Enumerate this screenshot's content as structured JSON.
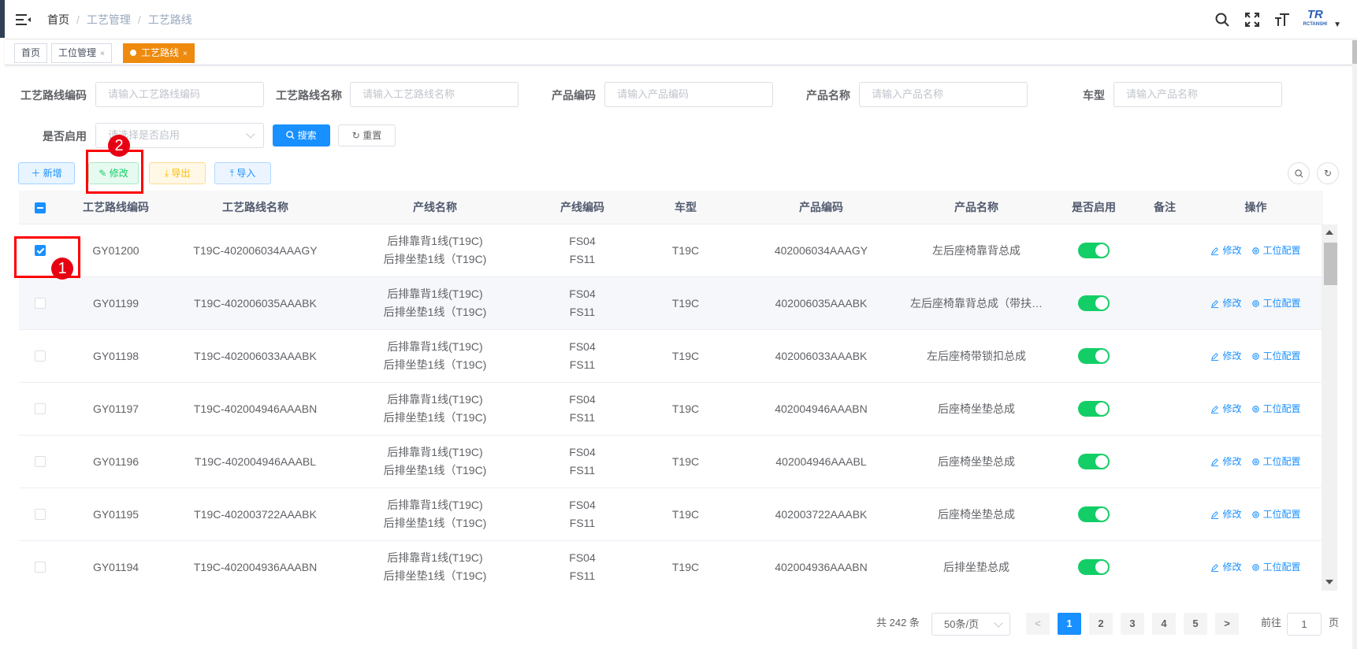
{
  "breadcrumb": {
    "home": "首页",
    "level2": "工艺管理",
    "level3": "工艺路线"
  },
  "top_icons": [
    "search-icon",
    "fullscreen-icon",
    "font-size-icon"
  ],
  "logo": {
    "text": "TR",
    "sub": "RCTANSHI"
  },
  "tags": [
    {
      "label": "首页",
      "closable": false,
      "active": false
    },
    {
      "label": "工位管理",
      "closable": true,
      "active": false
    },
    {
      "label": "工艺路线",
      "closable": true,
      "active": true
    }
  ],
  "tag_close": "×",
  "filters": {
    "route_code": {
      "label": "工艺路线编码",
      "placeholder": "请输入工艺路线编码"
    },
    "route_name": {
      "label": "工艺路线名称",
      "placeholder": "请输入工艺路线名称"
    },
    "product_code": {
      "label": "产品编码",
      "placeholder": "请输入产品编码"
    },
    "product_name": {
      "label": "产品名称",
      "placeholder": "请输入产品名称"
    },
    "car_model": {
      "label": "车型",
      "placeholder": "请输入产品名称"
    },
    "enabled": {
      "label": "是否启用",
      "placeholder": "请选择是否启用"
    }
  },
  "buttons": {
    "search": "搜索",
    "reset": "重置",
    "add": "新增",
    "edit": "修改",
    "export": "导出",
    "import": "导入"
  },
  "columns": [
    "工艺路线编码",
    "工艺路线名称",
    "产线名称",
    "产线编码",
    "车型",
    "产品编码",
    "产品名称",
    "是否启用",
    "备注",
    "操作"
  ],
  "rows": [
    {
      "code": "GY01200",
      "name": "T19C-402006034AAAGY",
      "line1": "后排靠背1线(T19C)",
      "line2": "后排坐垫1线（T19C)",
      "lc1": "FS04",
      "lc2": "FS11",
      "model": "T19C",
      "pcode": "402006034AAAGY",
      "pname": "左后座椅靠背总成",
      "enabled": true,
      "remark": "",
      "checked": true
    },
    {
      "code": "GY01199",
      "name": "T19C-402006035AAABK",
      "line1": "后排靠背1线(T19C)",
      "line2": "后排坐垫1线（T19C)",
      "lc1": "FS04",
      "lc2": "FS11",
      "model": "T19C",
      "pcode": "402006035AAABK",
      "pname": "左后座椅靠背总成（带扶…",
      "enabled": true,
      "remark": "",
      "checked": false
    },
    {
      "code": "GY01198",
      "name": "T19C-402006033AAABK",
      "line1": "后排靠背1线(T19C)",
      "line2": "后排坐垫1线（T19C)",
      "lc1": "FS04",
      "lc2": "FS11",
      "model": "T19C",
      "pcode": "402006033AAABK",
      "pname": "左后座椅带锁扣总成",
      "enabled": true,
      "remark": "",
      "checked": false
    },
    {
      "code": "GY01197",
      "name": "T19C-402004946AAABN",
      "line1": "后排靠背1线(T19C)",
      "line2": "后排坐垫1线（T19C)",
      "lc1": "FS04",
      "lc2": "FS11",
      "model": "T19C",
      "pcode": "402004946AAABN",
      "pname": "后座椅坐垫总成",
      "enabled": true,
      "remark": "",
      "checked": false
    },
    {
      "code": "GY01196",
      "name": "T19C-402004946AAABL",
      "line1": "后排靠背1线(T19C)",
      "line2": "后排坐垫1线（T19C)",
      "lc1": "FS04",
      "lc2": "FS11",
      "model": "T19C",
      "pcode": "402004946AAABL",
      "pname": "后座椅坐垫总成",
      "enabled": true,
      "remark": "",
      "checked": false
    },
    {
      "code": "GY01195",
      "name": "T19C-402003722AAABK",
      "line1": "后排靠背1线(T19C)",
      "line2": "后排坐垫1线（T19C)",
      "lc1": "FS04",
      "lc2": "FS11",
      "model": "T19C",
      "pcode": "402003722AAABK",
      "pname": "后座椅坐垫总成",
      "enabled": true,
      "remark": "",
      "checked": false
    },
    {
      "code": "GY01194",
      "name": "T19C-402004936AAABN",
      "line1": "后排靠背1线(T19C)",
      "line2": "后排坐垫1线（T19C)",
      "lc1": "FS04",
      "lc2": "FS11",
      "model": "T19C",
      "pcode": "402004936AAABN",
      "pname": "后排坐垫总成",
      "enabled": true,
      "remark": "",
      "checked": false
    }
  ],
  "row_actions": {
    "edit": "修改",
    "config": "工位配置"
  },
  "pagination": {
    "total_text": "共 242 条",
    "page_size": "50条/页",
    "pages": [
      "1",
      "2",
      "3",
      "4",
      "5"
    ],
    "current": "1",
    "goto_label": "前往",
    "goto_value": "1",
    "page_suffix": "页",
    "prev": "<",
    "next": ">"
  },
  "annotations": {
    "badge1": "1",
    "badge2": "2"
  },
  "colors": {
    "primary": "#1890ff",
    "tag_active": "#ee8a0d",
    "switch_on": "#13ce66",
    "annotation": "#ff0000"
  }
}
